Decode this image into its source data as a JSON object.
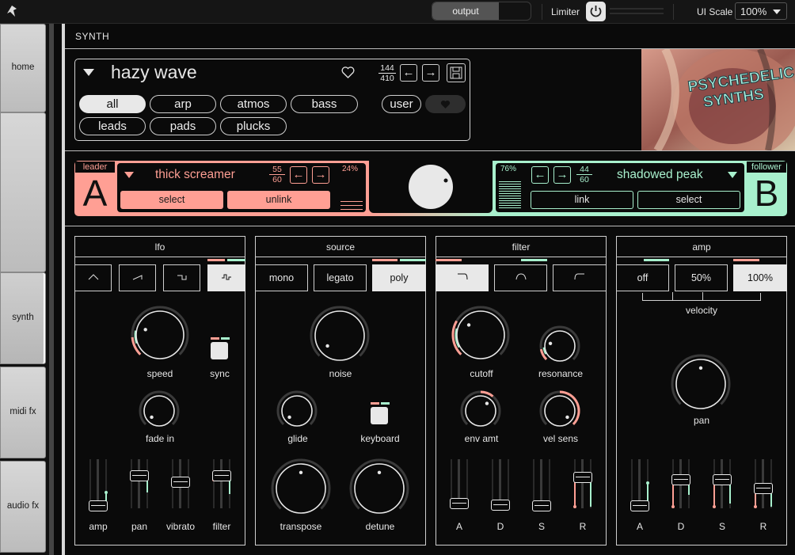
{
  "topbar": {
    "output_label": "output",
    "limiter_label": "Limiter",
    "ui_scale_label": "UI Scale",
    "ui_scale_value": "100%"
  },
  "nav": {
    "home": "home",
    "synth": "synth",
    "midi_fx": "midi fx",
    "audio_fx": "audio fx"
  },
  "page_title": "SYNTH",
  "preset": {
    "name": "hazy wave",
    "index": "144",
    "total": "410",
    "filters": {
      "all": "all",
      "arp": "arp",
      "atmos": "atmos",
      "bass": "bass",
      "user": "user",
      "leads": "leads",
      "pads": "pads",
      "plucks": "plucks"
    },
    "banner_text": "PSYCHEDELIC SYNTHS"
  },
  "layer_a": {
    "role": "leader",
    "letter": "A",
    "preset": "thick screamer",
    "index": "55",
    "total": "60",
    "percent": "24%",
    "select": "select",
    "unlink": "unlink"
  },
  "layer_b": {
    "role": "follower",
    "letter": "B",
    "preset": "shadowed peak",
    "index": "44",
    "total": "60",
    "percent": "76%",
    "link": "link",
    "select": "select"
  },
  "mix_knob": {
    "value": 0.5
  },
  "lfo": {
    "title": "lfo",
    "speed": "speed",
    "sync": "sync",
    "fade_in": "fade in",
    "amp": "amp",
    "pan": "pan",
    "vibrato": "vibrato",
    "filter": "filter"
  },
  "source": {
    "title": "source",
    "mono": "mono",
    "legato": "legato",
    "poly": "poly",
    "noise": "noise",
    "glide": "glide",
    "keyboard": "keyboard",
    "transpose": "transpose",
    "detune": "detune"
  },
  "filter": {
    "title": "filter",
    "cutoff": "cutoff",
    "resonance": "resonance",
    "env_amt": "env amt",
    "vel_sens": "vel sens",
    "a": "A",
    "d": "D",
    "s": "S",
    "r": "R"
  },
  "amp": {
    "title": "amp",
    "off": "off",
    "p50": "50%",
    "p100": "100%",
    "velocity": "velocity",
    "pan": "pan",
    "a": "A",
    "d": "D",
    "s": "S",
    "r": "R"
  },
  "colors": {
    "pink": "#ff9f94",
    "green": "#a8f0cd",
    "light": "#e8e8e8"
  },
  "icons": [
    "logo-icon",
    "power-icon",
    "dropdown-icon",
    "heart-icon",
    "arrow-left-icon",
    "arrow-right-icon",
    "save-icon",
    "sine-wave-icon",
    "saw-wave-icon",
    "square-wave-icon",
    "random-wave-icon",
    "lowpass-icon",
    "bandpass-icon",
    "highpass-icon"
  ]
}
